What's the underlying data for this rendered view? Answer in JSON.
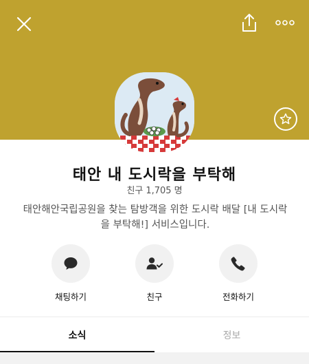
{
  "profile": {
    "name": "태안 내 도시락을 부탁해",
    "friend_prefix": "친구",
    "friend_count": "1,705",
    "friend_unit": "명",
    "description": "태안해안국립공원을 찾는 탐방객을 위한 도시락 배달 [내 도시락을 부탁해!] 서비스입니다."
  },
  "actions": {
    "chat_label": "채팅하기",
    "friend_label": "친구",
    "call_label": "전화하기"
  },
  "tabs": {
    "news": "소식",
    "info": "정보"
  },
  "colors": {
    "header_bg": "#bfa22f",
    "action_bg": "#f1f1f1"
  },
  "icons": [
    "close-icon",
    "share-icon",
    "more-icon",
    "star-icon",
    "chat-bubble-icon",
    "person-check-icon",
    "phone-icon"
  ]
}
